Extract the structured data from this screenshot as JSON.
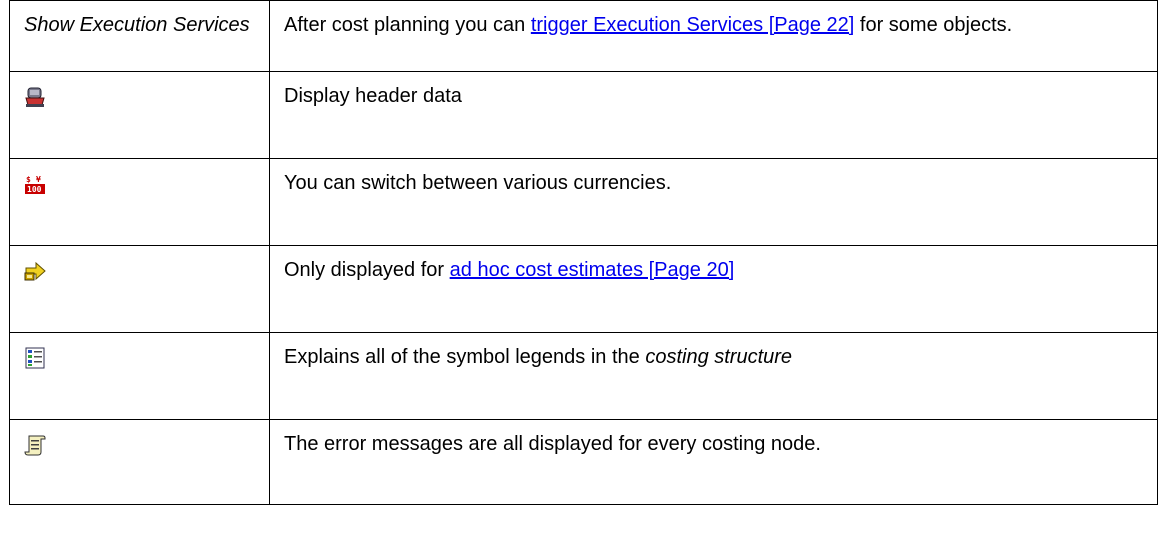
{
  "header_row": {
    "left_label": "Show Execution Services",
    "text_before_link": "After cost planning you can ",
    "link_text": "trigger Execution Services [Page 22]",
    "text_after_link": " for some objects."
  },
  "rows": [
    {
      "icon": "header-data-icon",
      "text": "Display header data"
    },
    {
      "icon": "currency-icon",
      "text": "You can switch between various currencies."
    },
    {
      "icon": "ad-hoc-estimate-icon",
      "text_before_link": "Only displayed for ",
      "link_text": "ad hoc cost estimates [Page 20]"
    },
    {
      "icon": "legend-icon",
      "text_before_italic": "Explains all of the symbol legends in the ",
      "italic_text": "costing structure"
    },
    {
      "icon": "message-log-icon",
      "text": "The error messages are all displayed for every costing node."
    }
  ],
  "colors": {
    "link": "#0000ee",
    "border": "#000000",
    "text": "#000000"
  }
}
